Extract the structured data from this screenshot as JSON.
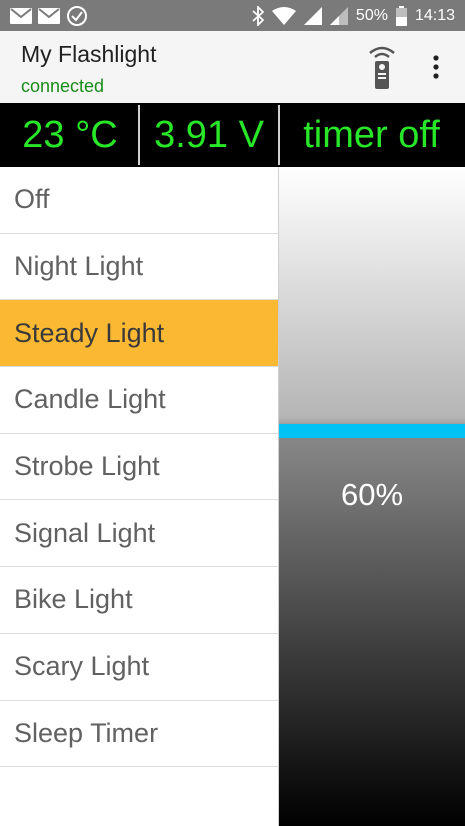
{
  "status_bar": {
    "battery_percent": "50%",
    "time": "14:13",
    "icons": [
      "mail-icon",
      "mail-icon",
      "check-circle-icon",
      "bluetooth-icon",
      "wifi-icon",
      "signal-icon",
      "signal-icon",
      "battery-icon"
    ]
  },
  "appbar": {
    "title": "My Flashlight",
    "subtitle": "connected",
    "remote_icon": "remote-control-icon",
    "menu_icon": "overflow-menu-icon"
  },
  "readouts": {
    "temperature": "23 °C",
    "voltage": "3.91 V",
    "timer": "timer off"
  },
  "modes": [
    {
      "label": "Off",
      "selected": false
    },
    {
      "label": "Night Light",
      "selected": false
    },
    {
      "label": "Steady Light",
      "selected": true
    },
    {
      "label": "Candle Light",
      "selected": false
    },
    {
      "label": "Strobe Light",
      "selected": false
    },
    {
      "label": "Signal Light",
      "selected": false
    },
    {
      "label": "Bike Light",
      "selected": false
    },
    {
      "label": "Scary Light",
      "selected": false
    },
    {
      "label": "Sleep Timer",
      "selected": false
    }
  ],
  "brightness": {
    "label": "60%",
    "level": 0.6
  },
  "colors": {
    "accent_selected": "#fbb933",
    "readout_text": "#28e628",
    "connected_text": "#1a8c1a",
    "slider_handle": "#00c2f5"
  }
}
